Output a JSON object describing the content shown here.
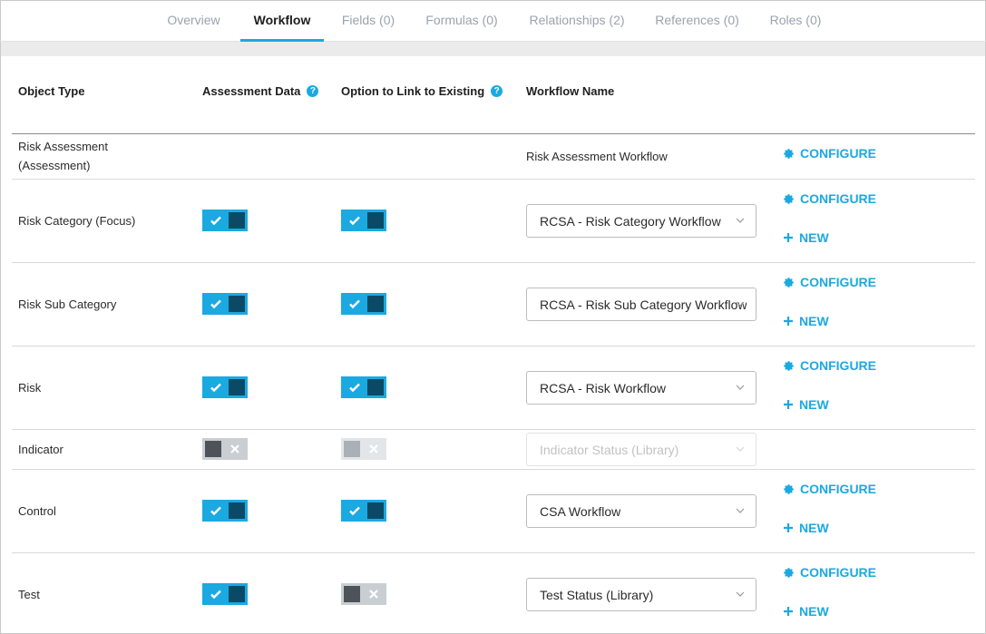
{
  "tabs": [
    {
      "label": "Overview",
      "active": false
    },
    {
      "label": "Workflow",
      "active": true
    },
    {
      "label": "Fields (0)",
      "active": false
    },
    {
      "label": "Formulas (0)",
      "active": false
    },
    {
      "label": "Relationships (2)",
      "active": false
    },
    {
      "label": "References (0)",
      "active": false
    },
    {
      "label": "Roles (0)",
      "active": false
    }
  ],
  "table": {
    "headers": {
      "object_type": "Object Type",
      "assessment_data": "Assessment Data",
      "option_to_link": "Option to Link to Existing",
      "workflow_name": "Workflow Name"
    },
    "rows": [
      {
        "object_type": "Risk Assessment\n(Assessment)",
        "assessment_data": null,
        "option_to_link": null,
        "workflow": "Risk Assessment Workflow",
        "workflow_editable": false,
        "configure": "CONFIGURE",
        "new": null
      },
      {
        "object_type": "Risk Category (Focus)",
        "assessment_data": "on",
        "option_to_link": "on",
        "workflow": "RCSA - Risk Category Workflow",
        "workflow_editable": true,
        "configure": "CONFIGURE",
        "new": "NEW"
      },
      {
        "object_type": "Risk Sub Category",
        "assessment_data": "on",
        "option_to_link": "on",
        "workflow": "RCSA - Risk Sub Category Workflow",
        "workflow_editable": true,
        "configure": "CONFIGURE",
        "new": "NEW"
      },
      {
        "object_type": "Risk",
        "assessment_data": "on",
        "option_to_link": "on",
        "workflow": "RCSA - Risk Workflow",
        "workflow_editable": true,
        "configure": "CONFIGURE",
        "new": "NEW"
      },
      {
        "object_type": "Indicator",
        "assessment_data": "off",
        "option_to_link": "disabled",
        "workflow": "Indicator Status (Library)",
        "workflow_editable": false,
        "configure": null,
        "new": null
      },
      {
        "object_type": "Control",
        "assessment_data": "on",
        "option_to_link": "on",
        "workflow": "CSA Workflow",
        "workflow_editable": true,
        "configure": "CONFIGURE",
        "new": "NEW"
      },
      {
        "object_type": "Test",
        "assessment_data": "on",
        "option_to_link": "off",
        "workflow": "Test Status (Library)",
        "workflow_editable": true,
        "configure": "CONFIGURE",
        "new": "NEW"
      }
    ]
  },
  "icons": {
    "help": "help-circle-icon",
    "check": "check-icon",
    "cross": "x-icon",
    "chevron": "chevron-down-icon",
    "gear": "gear-icon",
    "plus": "plus-icon",
    "help_glyph": "?"
  },
  "colors": {
    "accent": "#1ba9e1",
    "toggle_knob_on": "#0a4a66",
    "toggle_off": "#c9ced3",
    "text": "#2b2b2b",
    "muted_tab": "#9aa3ad"
  }
}
